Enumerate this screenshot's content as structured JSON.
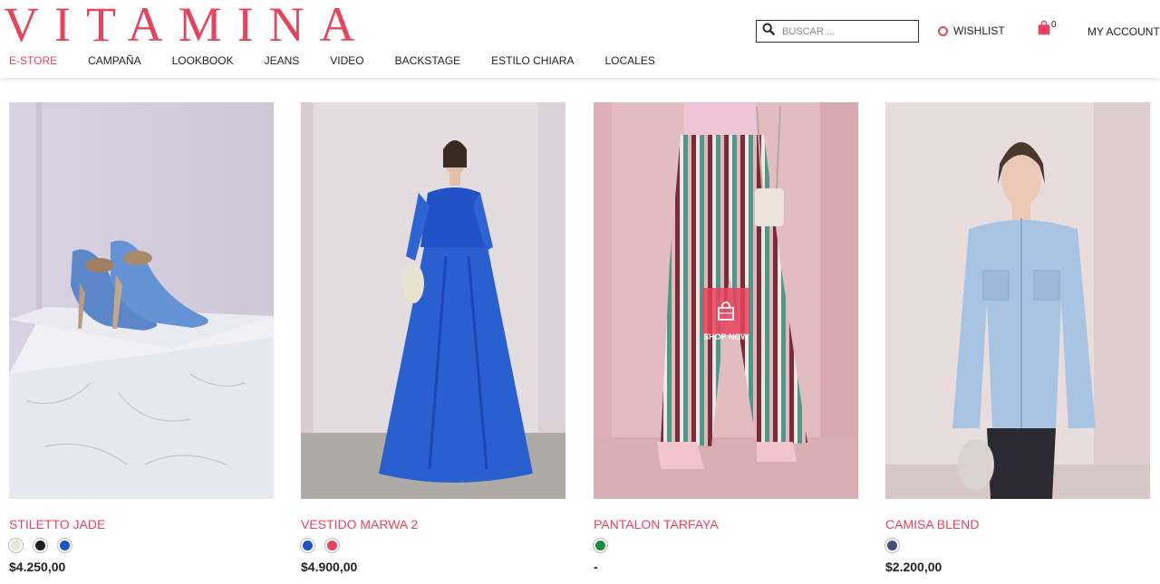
{
  "brand": {
    "logo": "VITAMINA",
    "accent_color": "#e8435a"
  },
  "nav": {
    "items": [
      "E-STORE",
      "CAMPAÑA",
      "LOOKBOOK",
      "JEANS",
      "VIDEO",
      "BACKSTAGE",
      "ESTILO CHIARA",
      "LOCALES"
    ],
    "active": "E-STORE"
  },
  "search": {
    "placeholder": "BUSCAR ...",
    "value": "",
    "icon": "search-icon"
  },
  "header": {
    "wishlist_label": "WISHLIST",
    "cart_count": "0",
    "account_label": "MY ACCOUNT"
  },
  "overlay": {
    "label": "SHOP NOW",
    "icon": "shopping-bag-icon"
  },
  "products": [
    {
      "name": "STILETTO JADE",
      "price": "$4.250,00",
      "colors": [
        "#e8e3dc",
        "#1f1f1f",
        "#1d54c4"
      ]
    },
    {
      "name": "VESTIDO MARWA 2",
      "price": "$4.900,00",
      "colors": [
        "#1d54c4",
        "#e8435a"
      ]
    },
    {
      "name": "PANTALON TARFAYA",
      "price": "-",
      "colors": [
        "#1e8a3c"
      ]
    },
    {
      "name": "CAMISA BLEND",
      "price": "$2.200,00",
      "colors": [
        "#44507a"
      ]
    }
  ]
}
